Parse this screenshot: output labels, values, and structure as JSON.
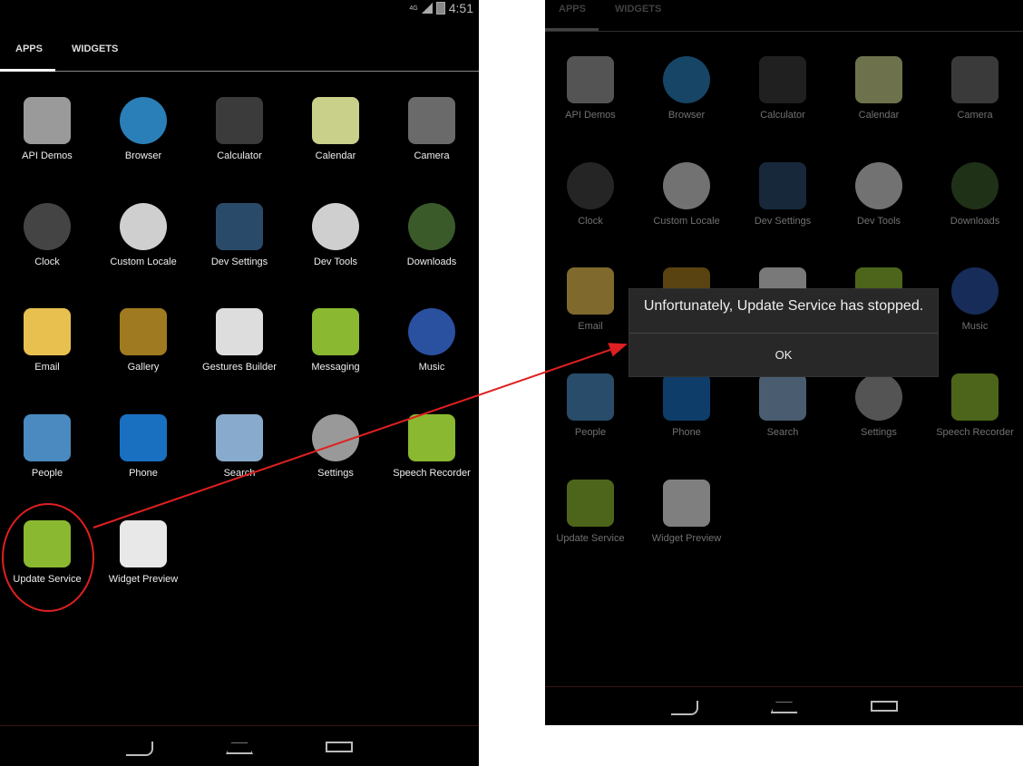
{
  "status_bar": {
    "network": "4G",
    "time": "4:51"
  },
  "tabs": [
    "APPS",
    "WIDGETS"
  ],
  "apps": [
    {
      "label": "API Demos",
      "icon": "folder-gear-icon",
      "color": "#9a9a9a"
    },
    {
      "label": "Browser",
      "icon": "globe-icon",
      "color": "#2a7fb8"
    },
    {
      "label": "Calculator",
      "icon": "calculator-icon",
      "color": "#3b3b3b"
    },
    {
      "label": "Calendar",
      "icon": "calendar-icon",
      "color": "#c8d08a"
    },
    {
      "label": "Camera",
      "icon": "camera-icon",
      "color": "#6a6a6a"
    },
    {
      "label": "Clock",
      "icon": "clock-icon",
      "color": "#444"
    },
    {
      "label": "Custom Locale",
      "icon": "gear-icon",
      "color": "#cfcfcf"
    },
    {
      "label": "Dev Settings",
      "icon": "sliders-icon",
      "color": "#2a4a6a"
    },
    {
      "label": "Dev Tools",
      "icon": "gear-icon",
      "color": "#cfcfcf"
    },
    {
      "label": "Downloads",
      "icon": "download-icon",
      "color": "#3a5a2a"
    },
    {
      "label": "Email",
      "icon": "email-icon",
      "color": "#e8c050"
    },
    {
      "label": "Gallery",
      "icon": "gallery-icon",
      "color": "#a07a20"
    },
    {
      "label": "Gestures Builder",
      "icon": "gestures-icon",
      "color": "#ddd"
    },
    {
      "label": "Messaging",
      "icon": "messaging-icon",
      "color": "#8ab830"
    },
    {
      "label": "Music",
      "icon": "music-icon",
      "color": "#2a50a0"
    },
    {
      "label": "People",
      "icon": "people-icon",
      "color": "#4a8ac0"
    },
    {
      "label": "Phone",
      "icon": "phone-icon",
      "color": "#1a70c0"
    },
    {
      "label": "Search",
      "icon": "search-icon",
      "color": "#88aacc"
    },
    {
      "label": "Settings",
      "icon": "settings-icon",
      "color": "#999"
    },
    {
      "label": "Speech Recorder",
      "icon": "android-icon",
      "color": "#8ab830"
    },
    {
      "label": "Update Service",
      "icon": "android-icon",
      "color": "#8ab830"
    },
    {
      "label": "Widget Preview",
      "icon": "widget-preview-icon",
      "color": "#e8e8e8"
    }
  ],
  "dialog": {
    "message": "Unfortunately, Update Service has stopped.",
    "ok_label": "OK"
  },
  "annotation": {
    "color": "#e02020"
  },
  "nav": [
    "back-icon",
    "home-icon",
    "recents-icon"
  ]
}
